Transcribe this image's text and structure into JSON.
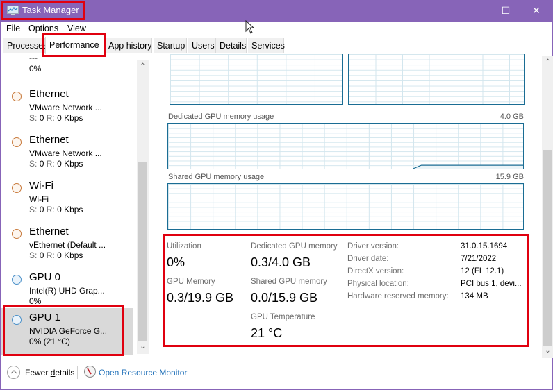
{
  "window": {
    "title": "Task Manager",
    "controls": {
      "minimize": "—",
      "maximize": "☐",
      "close": "✕"
    }
  },
  "menu": [
    "File",
    "Options",
    "View"
  ],
  "tabs": [
    {
      "label": "Processes",
      "active": false
    },
    {
      "label": "Performance",
      "active": true
    },
    {
      "label": "App history",
      "active": false
    },
    {
      "label": "Startup",
      "active": false
    },
    {
      "label": "Users",
      "active": false
    },
    {
      "label": "Details",
      "active": false
    },
    {
      "label": "Services",
      "active": false
    }
  ],
  "sidebar": {
    "top_partial": {
      "dash": "---",
      "stat": "0%"
    },
    "items": [
      {
        "name": "Ethernet",
        "sub": "VMware Network ...",
        "s_label": "S:",
        "s_val": "0",
        "r_label": "R:",
        "r_val": "0 Kbps",
        "kind": "network"
      },
      {
        "name": "Ethernet",
        "sub": "VMware Network ...",
        "s_label": "S:",
        "s_val": "0",
        "r_label": "R:",
        "r_val": "0 Kbps",
        "kind": "network"
      },
      {
        "name": "Wi-Fi",
        "sub": "Wi-Fi",
        "s_label": "S:",
        "s_val": "0",
        "r_label": "R:",
        "r_val": "0 Kbps",
        "kind": "network"
      },
      {
        "name": "Ethernet",
        "sub": "vEthernet (Default ...",
        "s_label": "S:",
        "s_val": "0",
        "r_label": "R:",
        "r_val": "0 Kbps",
        "kind": "network"
      },
      {
        "name": "GPU 0",
        "sub": "Intel(R) UHD Grap...",
        "stat": "0%",
        "kind": "gpu"
      },
      {
        "name": "GPU 1",
        "sub": "NVIDIA GeForce G...",
        "stat": "0%  (21 °C)",
        "kind": "gpu",
        "selected": true
      }
    ]
  },
  "graphs": {
    "dedicated": {
      "label": "Dedicated GPU memory usage",
      "max": "4.0 GB",
      "current_fraction": 0.075
    },
    "shared": {
      "label": "Shared GPU memory usage",
      "max": "15.9 GB",
      "current_fraction": 0.0
    }
  },
  "stats": {
    "utilization": {
      "label": "Utilization",
      "value": "0%"
    },
    "gpu_memory": {
      "label": "GPU Memory",
      "value": "0.3/19.9 GB"
    },
    "dedicated": {
      "label": "Dedicated GPU memory",
      "value": "0.3/4.0 GB"
    },
    "shared": {
      "label": "Shared GPU memory",
      "value": "0.0/15.9 GB"
    },
    "temperature": {
      "label": "GPU Temperature",
      "value": "21 °C"
    }
  },
  "details": [
    {
      "key": "Driver version:",
      "value": "31.0.15.1694"
    },
    {
      "key": "Driver date:",
      "value": "7/21/2022"
    },
    {
      "key": "DirectX version:",
      "value": "12 (FL 12.1)"
    },
    {
      "key": "Physical location:",
      "value": "PCI bus 1, devi..."
    },
    {
      "key": "Hardware reserved memory:",
      "value": "134 MB"
    }
  ],
  "footer": {
    "fewer_details_pre": "Fewer ",
    "fewer_details_u": "d",
    "fewer_details_post": "etails",
    "open_resource_monitor": "Open Resource Monitor"
  }
}
